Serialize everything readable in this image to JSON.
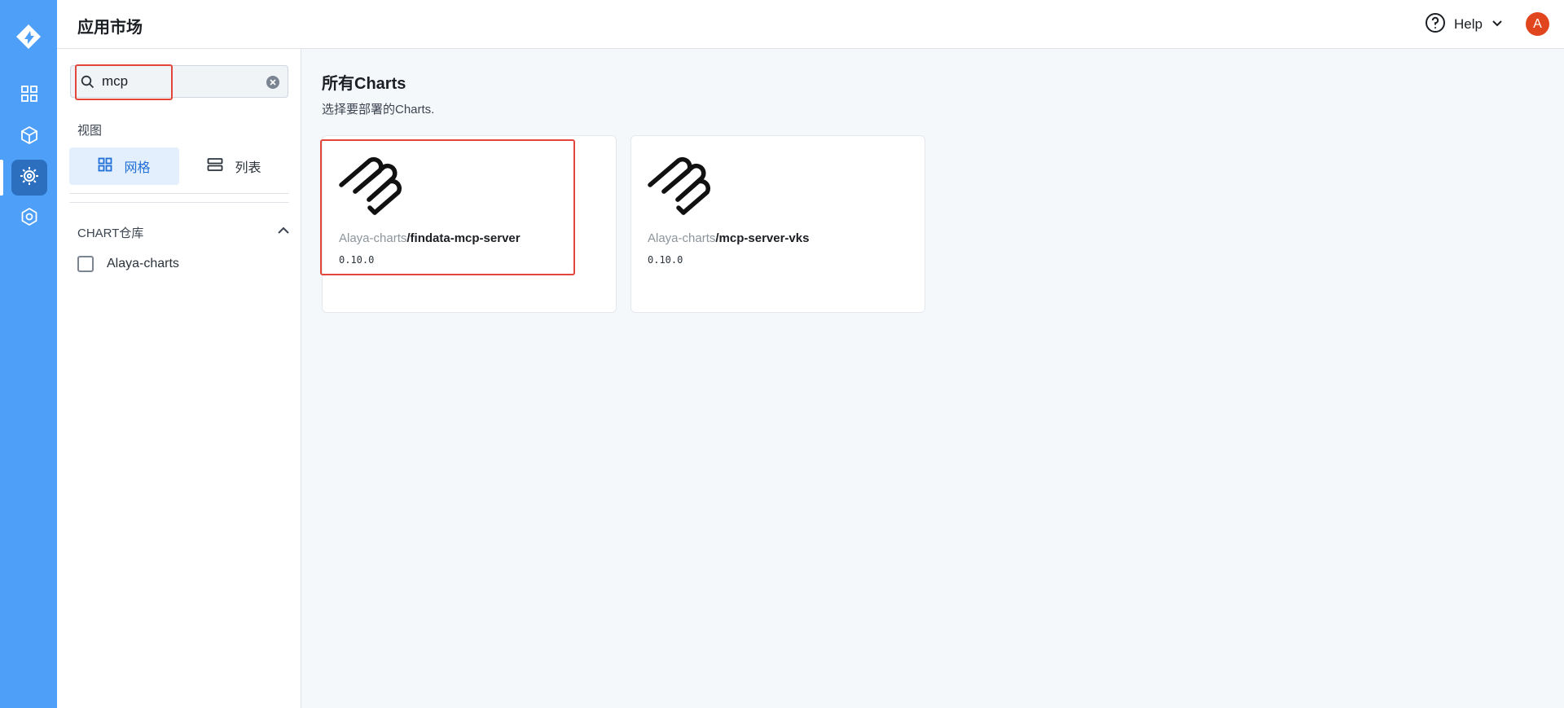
{
  "nav": {
    "logo_icon": "product-logo-icon",
    "items": [
      {
        "icon": "dashboard-grid-icon",
        "active": false
      },
      {
        "icon": "cube-icon",
        "active": false
      },
      {
        "icon": "app-market-gear-icon",
        "active": true
      },
      {
        "icon": "settings-gear-icon",
        "active": false
      }
    ]
  },
  "header": {
    "title": "应用市场",
    "help_label": "Help",
    "avatar_initial": "A",
    "avatar_color": "#e0451d"
  },
  "sidebar": {
    "search": {
      "value": "mcp"
    },
    "view_label": "视图",
    "view_options": [
      {
        "label": "网格",
        "icon": "grid-icon",
        "active": true
      },
      {
        "label": "列表",
        "icon": "list-icon",
        "active": false
      }
    ],
    "repo_section": {
      "title": "CHART仓库",
      "collapsed": false,
      "items": [
        {
          "label": "Alaya-charts",
          "checked": false
        }
      ]
    }
  },
  "main": {
    "title": "所有Charts",
    "subtitle": "选择要部署的Charts.",
    "cards": [
      {
        "repo": "Alaya-charts",
        "name": "/findata-mcp-server",
        "version": "0.10.0"
      },
      {
        "repo": "Alaya-charts",
        "name": "/mcp-server-vks",
        "version": "0.10.0"
      }
    ]
  },
  "colors": {
    "rail": "#4d9ff7",
    "rail_active": "#2c6fbf",
    "accent": "#1f6fd6",
    "highlight_box": "#e2463b"
  }
}
